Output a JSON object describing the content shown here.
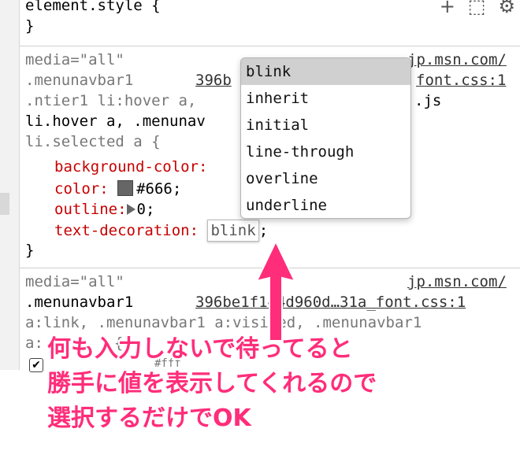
{
  "section1": {
    "line1": "element.style {",
    "line2": "}"
  },
  "toolbar_icons": [
    "plus-icon",
    "element-picker-icon",
    "gear-icon"
  ],
  "section2": {
    "media": "media=\"all\"",
    "source_link": "jp.msn.com/",
    "sel1_part": ".menunavbar1",
    "sel1_link": "396b",
    "font_link": "font.css:1",
    "sel2": ".ntier1 li:hover a,",
    "js_link": ".js",
    "sel3": "li.hover a, .menunav",
    "sel4": "li.selected a {",
    "prop_bg": "background-color:",
    "prop_color": "color:",
    "val_color": "#666;",
    "prop_outline": "outline:",
    "val_outline": "0;",
    "prop_td": "text-decoration:",
    "val_td": "blink",
    "semicolon": ";",
    "close": "}"
  },
  "dropdown": {
    "items": [
      "blink",
      "inherit",
      "initial",
      "line-through",
      "overline",
      "underline"
    ],
    "selected_index": 0
  },
  "section3": {
    "media": "media=\"all\"",
    "source_link": "jp.msn.com/",
    "sel1": ".menunavbar1",
    "file_link": "396be1f144d960d…31a_font.css:1",
    "sel2": "a:link, .menunavbar1 a:visited, .menunavbar1",
    "sel3_part": "a:",
    "sel3_tail": "{",
    "partial_line": "#fff"
  },
  "annotation": {
    "line1": "何も入力しないで待ってると",
    "line2": "勝手に値を表示してくれるので",
    "line3": "選択するだけでOK",
    "color": "#ff2d7a"
  }
}
